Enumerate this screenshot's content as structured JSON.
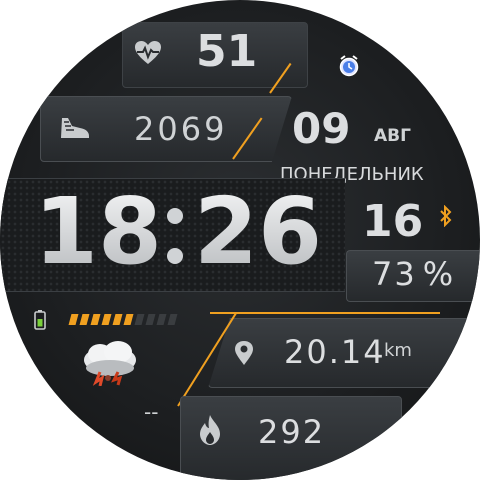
{
  "heart_rate": {
    "value": "51",
    "icon": "heart-pulse-icon"
  },
  "steps": {
    "value": "2069",
    "icon": "shoe-icon"
  },
  "alarm": {
    "icon": "alarm-clock-icon"
  },
  "date": {
    "day": "09",
    "month": "АВГ",
    "weekday": "ПОНЕДЕЛЬНИК"
  },
  "time": {
    "hours": "18",
    "minutes": "26"
  },
  "seconds": {
    "value": "16"
  },
  "bluetooth": {
    "icon": "bluetooth-icon",
    "color": "#f0a020"
  },
  "phone_battery": {
    "value": "73",
    "unit": "%"
  },
  "watch_battery": {
    "icon": "battery-icon",
    "level": 0.62,
    "segments": 10
  },
  "weather": {
    "icon": "storm-cloud-icon",
    "temperature": "--"
  },
  "distance": {
    "value": "20.14",
    "unit": "km",
    "icon": "location-pin-icon"
  },
  "calories": {
    "value": "292",
    "icon": "flame-icon"
  },
  "colors": {
    "accent": "#f0a020",
    "text": "#d8dadc"
  }
}
